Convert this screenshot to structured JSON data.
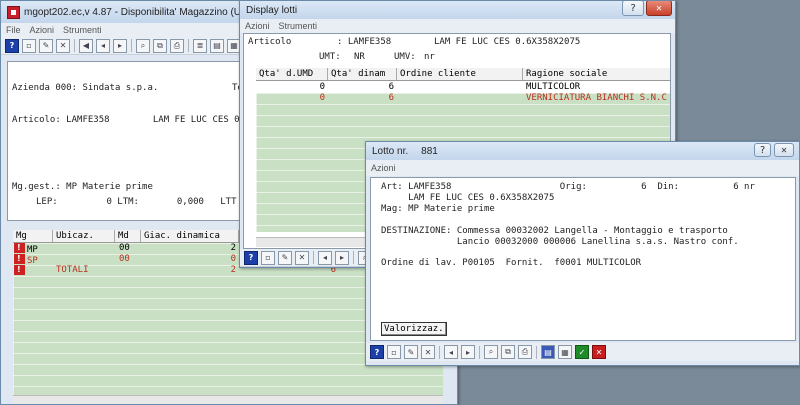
{
  "main_window": {
    "title": "mgopt202.ec,v 4.87 - Disponibilita' Magazzino (Ufficio Produ",
    "menu": [
      "File",
      "Azioni",
      "Strumenti"
    ],
    "azienda_line": "Azienda 000: Sindata s.p.a.",
    "azienda_trunc": "Te",
    "articolo_line": "Articolo: LAMFE358        LAM FE LUC CES 0",
    "mggest_line": "Mg.gest.: MP Materie prime",
    "lep_line": "LEP:         0 LTM:       0,000   LTT",
    "columns": [
      "Mg",
      "Ubicaz.",
      "Md",
      "Giac. dinamica"
    ],
    "rows": [
      {
        "mg": "MP",
        "ubicaz": "",
        "md": "00",
        "giac": "2"
      },
      {
        "mg": "SP",
        "ubicaz": "",
        "md": "00",
        "giac": "0"
      },
      {
        "mg": "",
        "ubicaz": "TOTALI",
        "md": "",
        "giac": "2"
      }
    ],
    "extra_total": "6"
  },
  "display_lotti": {
    "title": "Display lotti",
    "menu": [
      "Azioni",
      "Strumenti"
    ],
    "articolo_label": "Articolo",
    "articolo_value": ": LAMFE358",
    "articolo_desc": "LAM FE LUC CES 0.6X358X2075",
    "umt_label": "UMT:",
    "umt_value": "NR",
    "umv_label": "UMV:",
    "umv_value": "nr",
    "columns": [
      "Qta' d.UMD",
      "Qta' dinam",
      "Ordine cliente",
      "Ragione sociale"
    ],
    "rows": [
      {
        "qta_umd": "0",
        "qta_din": "6",
        "ordine": "",
        "ragione": "MULTICOLOR"
      },
      {
        "qta_umd": "0",
        "qta_din": "6",
        "ordine": "",
        "ragione": "VERNICIATURA BIANCHI S.N.C"
      }
    ]
  },
  "lotto_window": {
    "title_label": "Lotto nr.",
    "title_value": "881",
    "menu": [
      "Azioni"
    ],
    "art_line": "Art: LAMFE358                    Orig:          6  Din:          6 nr",
    "desc_line": "     LAM FE LUC CES 0.6X358X2075",
    "mag_line": "Mag: MP Materie prime",
    "dest_line1": "DESTINAZIONE: Commessa 00032002 Langella - Montaggio e trasporto",
    "dest_line2": "              Lancio 00032000 000006 Lanellina s.a.s. Nastro conf.",
    "ordine_line": "Ordine di lav. P00105  Fornit.  f0001 MULTICOLOR",
    "valorizz_label": "Valorizzaz."
  },
  "colors": {
    "grid_green": "#c9e0c4",
    "selected_row_text": "#b8311e",
    "title_bar": "#c3d6ec"
  }
}
